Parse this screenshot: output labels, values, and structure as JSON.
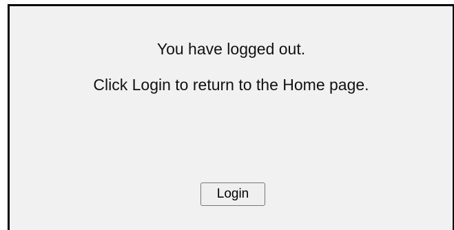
{
  "logout_panel": {
    "message_line_1": "You have logged out.",
    "message_line_2": "Click Login to return to the Home page.",
    "login_button_label": "Login"
  }
}
